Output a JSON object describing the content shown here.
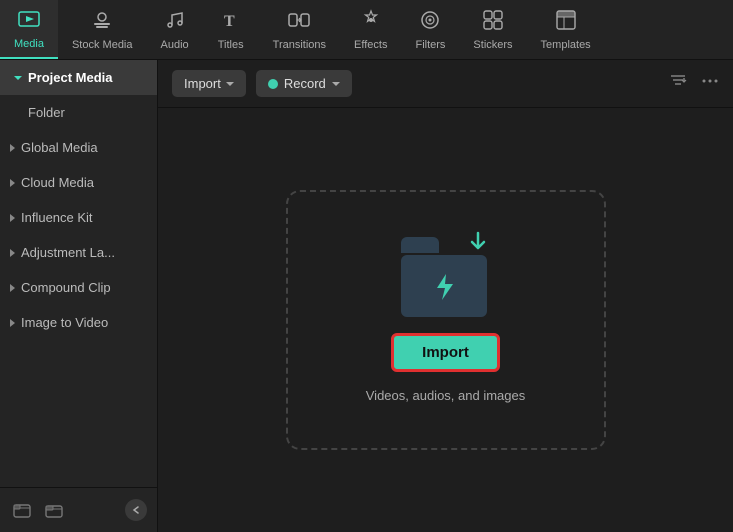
{
  "topNav": {
    "items": [
      {
        "id": "media",
        "label": "Media",
        "icon": "media-icon",
        "active": true
      },
      {
        "id": "stock-media",
        "label": "Stock Media",
        "icon": "stock-media-icon",
        "active": false
      },
      {
        "id": "audio",
        "label": "Audio",
        "icon": "audio-icon",
        "active": false
      },
      {
        "id": "titles",
        "label": "Titles",
        "icon": "titles-icon",
        "active": false
      },
      {
        "id": "transitions",
        "label": "Transitions",
        "icon": "transitions-icon",
        "active": false
      },
      {
        "id": "effects",
        "label": "Effects",
        "icon": "effects-icon",
        "active": false
      },
      {
        "id": "filters",
        "label": "Filters",
        "icon": "filters-icon",
        "active": false
      },
      {
        "id": "stickers",
        "label": "Stickers",
        "icon": "stickers-icon",
        "active": false
      },
      {
        "id": "templates",
        "label": "Templates",
        "icon": "templates-icon",
        "active": false
      }
    ]
  },
  "sidebar": {
    "header": "Project Media",
    "items": [
      {
        "id": "folder",
        "label": "Folder",
        "indent": true,
        "hasArrow": false
      },
      {
        "id": "global-media",
        "label": "Global Media",
        "hasArrow": true
      },
      {
        "id": "cloud-media",
        "label": "Cloud Media",
        "hasArrow": true
      },
      {
        "id": "influence-kit",
        "label": "Influence Kit",
        "hasArrow": true
      },
      {
        "id": "adjustment-la",
        "label": "Adjustment La...",
        "hasArrow": true
      },
      {
        "id": "compound-clip",
        "label": "Compound Clip",
        "hasArrow": true
      },
      {
        "id": "image-to-video",
        "label": "Image to Video",
        "hasArrow": true
      }
    ],
    "footer": {
      "addIcon": "+",
      "folderIcon": "📁",
      "chevron": "<"
    }
  },
  "toolbar": {
    "import_label": "Import",
    "record_label": "Record"
  },
  "dropZone": {
    "import_btn_label": "Import",
    "description": "Videos, audios, and images"
  }
}
